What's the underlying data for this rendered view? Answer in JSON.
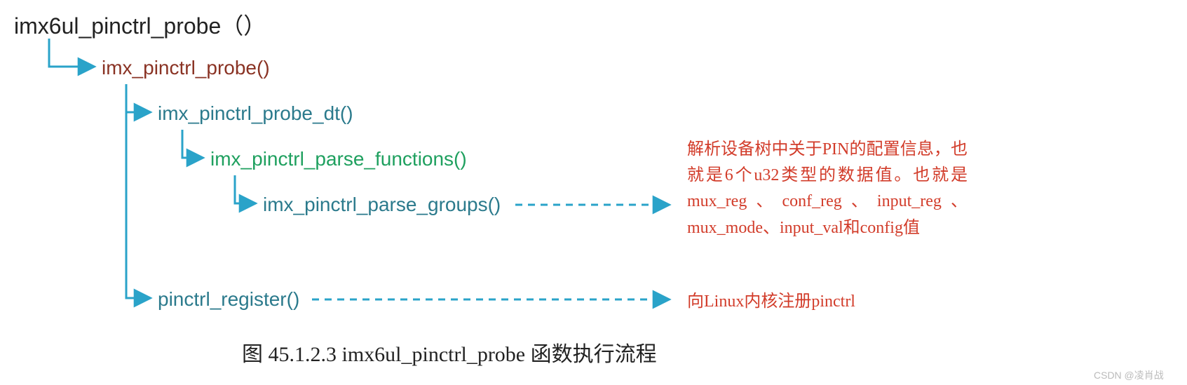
{
  "tree": {
    "root": "imx6ul_pinctrl_probe（）",
    "n1": "imx_pinctrl_probe()",
    "n2": "imx_pinctrl_probe_dt()",
    "n3": "imx_pinctrl_parse_functions()",
    "n4": "imx_pinctrl_parse_groups()",
    "n5": "pinctrl_register()"
  },
  "notes": {
    "groups": "解析设备树中关于PIN的配置信息，也就是6个u32类型的数据值。也就是mux_reg、conf_reg、input_reg、mux_mode、input_val和config值",
    "register": "向Linux内核注册pinctrl"
  },
  "caption": "图 45.1.2.3 imx6ul_pinctrl_probe 函数执行流程",
  "watermark": "CSDN @凌肖战",
  "colors": {
    "connector": "#2aa3c9",
    "arrow_fill": "#2aa3c9"
  }
}
